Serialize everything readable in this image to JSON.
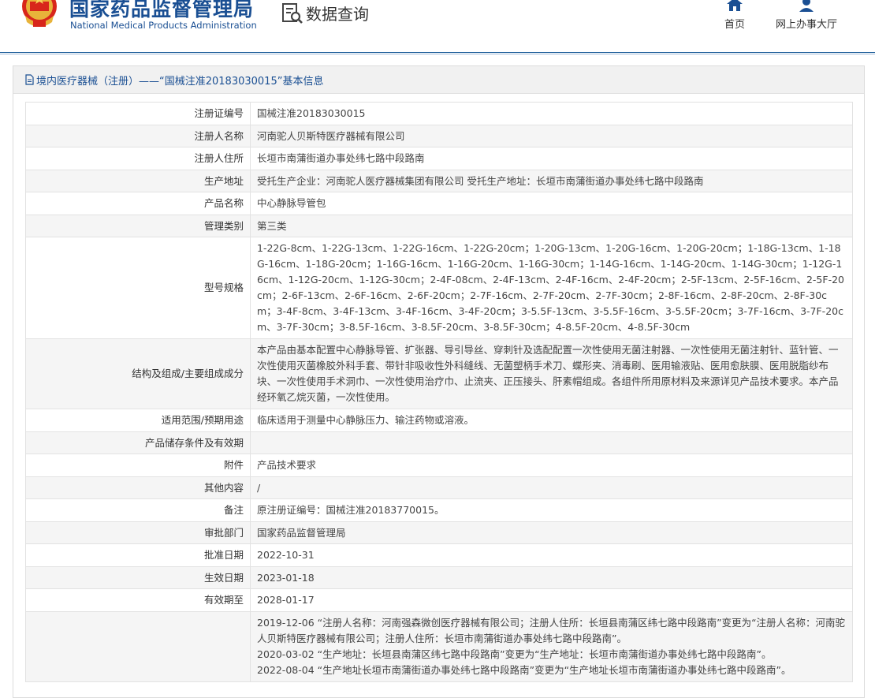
{
  "header": {
    "site_title_cn": "国家药品监督管理局",
    "site_title_en": "National Medical Products Administration",
    "section_title": "数据查询",
    "nav": [
      {
        "label": "首页",
        "icon": "home-icon"
      },
      {
        "label": "网上办事大厅",
        "icon": "user-icon"
      }
    ]
  },
  "panel": {
    "title": "境内医疗器械（注册）——“国械注准20183030015”基本信息",
    "title_icon": "document-icon"
  },
  "records": [
    {
      "label": "注册证编号",
      "value": "国械注准20183030015"
    },
    {
      "label": "注册人名称",
      "value": "河南驼人贝斯特医疗器械有限公司"
    },
    {
      "label": "注册人住所",
      "value": "长垣市南蒲街道办事处纬七路中段路南"
    },
    {
      "label": "生产地址",
      "value": "受托生产企业：河南驼人医疗器械集团有限公司 受托生产地址：长垣市南蒲街道办事处纬七路中段路南"
    },
    {
      "label": "产品名称",
      "value": "中心静脉导管包"
    },
    {
      "label": "管理类别",
      "value": "第三类"
    },
    {
      "label": "型号规格",
      "value": "1-22G-8cm、1-22G-13cm、1-22G-16cm、1-22G-20cm；1-20G-13cm、1-20G-16cm、1-20G-20cm；1-18G-13cm、1-18G-16cm、1-18G-20cm；1-16G-16cm、1-16G-20cm、1-16G-30cm；1-14G-16cm、1-14G-20cm、1-14G-30cm；1-12G-16cm、1-12G-20cm、1-12G-30cm；2-4F-08cm、2-4F-13cm、2-4F-16cm、2-4F-20cm；2-5F-13cm、2-5F-16cm、2-5F-20cm；2-6F-13cm、2-6F-16cm、2-6F-20cm；2-7F-16cm、2-7F-20cm、2-7F-30cm；2-8F-16cm、2-8F-20cm、2-8F-30cm；3-4F-8cm、3-4F-13cm、3-4F-16cm、3-4F-20cm；3-5.5F-13cm、3-5.5F-16cm、3-5.5F-20cm；3-7F-16cm、3-7F-20cm、3-7F-30cm；3-8.5F-16cm、3-8.5F-20cm、3-8.5F-30cm；4-8.5F-20cm、4-8.5F-30cm"
    },
    {
      "label": "结构及组成/主要组成成分",
      "value": "本产品由基本配置中心静脉导管、扩张器、导引导丝、穿刺针及选配配置一次性使用无菌注射器、一次性使用无菌注射针、蓝针管、一次性使用灭菌橡胶外科手套、带针非吸收性外科缝线、无菌塑柄手术刀、蝶形夹、消毒刷、医用输液贴、医用愈肤膜、医用脱脂纱布块、一次性使用手术洞巾、一次性使用治疗巾、止流夹、正压接头、肝素帽组成。各组件所用原材料及来源详见产品技术要求。本产品经环氧乙烷灭菌，一次性使用。"
    },
    {
      "label": "适用范围/预期用途",
      "value": "临床适用于测量中心静脉压力、输注药物或溶液。"
    },
    {
      "label": "产品储存条件及有效期",
      "value": ""
    },
    {
      "label": "附件",
      "value": "产品技术要求"
    },
    {
      "label": "其他内容",
      "value": "/"
    },
    {
      "label": "备注",
      "value": "原注册证编号：国械注准20183770015。"
    },
    {
      "label": "审批部门",
      "value": "国家药品监督管理局"
    },
    {
      "label": "批准日期",
      "value": "2022-10-31"
    },
    {
      "label": "生效日期",
      "value": "2023-01-18"
    },
    {
      "label": "有效期至",
      "value": "2028-01-17"
    }
  ],
  "history": [
    "2019-12-06 “注册人名称：河南强森微创医疗器械有限公司；注册人住所：长垣县南蒲区纬七路中段路南”变更为“注册人名称：河南驼人贝斯特医疗器械有限公司；注册人住所：长垣市南蒲街道办事处纬七路中段路南”。",
    "2020-03-02 “生产地址：长垣县南蒲区纬七路中段路南”变更为“生产地址：长垣市南蒲街道办事处纬七路中段路南”。",
    "2022-08-04 “生产地址长垣市南蒲街道办事处纬七路中段路南”变更为“生产地址长垣市南蒲街道办事处纬七路中段路南”。"
  ]
}
